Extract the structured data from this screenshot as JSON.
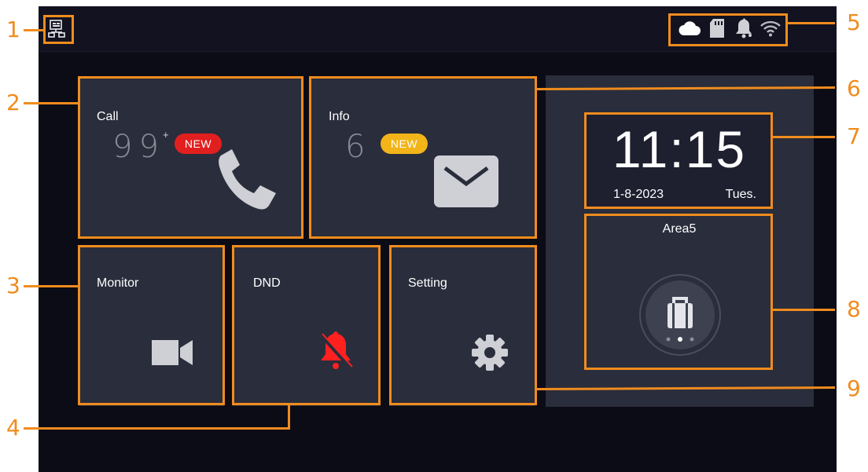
{
  "status_bar": {
    "network_icon": "network-topology-icon",
    "icons": [
      "cloud-icon",
      "sd-card-icon",
      "bell-icon",
      "wifi-icon"
    ]
  },
  "tiles": {
    "call": {
      "label": "Call",
      "count": "99",
      "count_suffix": "+",
      "badge": "NEW",
      "badge_color": "#e21f1f",
      "icon": "phone-icon"
    },
    "info": {
      "label": "Info",
      "count": "6",
      "badge": "NEW",
      "badge_color": "#f2b418",
      "icon": "envelope-icon"
    },
    "monitor": {
      "label": "Monitor",
      "icon": "video-camera-icon"
    },
    "dnd": {
      "label": "DND",
      "icon": "bell-off-icon",
      "icon_color": "#ff2020"
    },
    "setting": {
      "label": "Setting",
      "icon": "gear-icon"
    }
  },
  "clock": {
    "time": "11:15",
    "date": "1-8-2023",
    "weekday": "Tues."
  },
  "area": {
    "label": "Area5",
    "icon": "luggage-icon",
    "page_dots": 3,
    "active_dot": 1
  },
  "callouts": [
    "1",
    "2",
    "3",
    "4",
    "5",
    "6",
    "7",
    "8",
    "9"
  ],
  "colors": {
    "highlight": "#f08c1e",
    "tile": "#2a2d3b",
    "background": "#0c0c16"
  }
}
